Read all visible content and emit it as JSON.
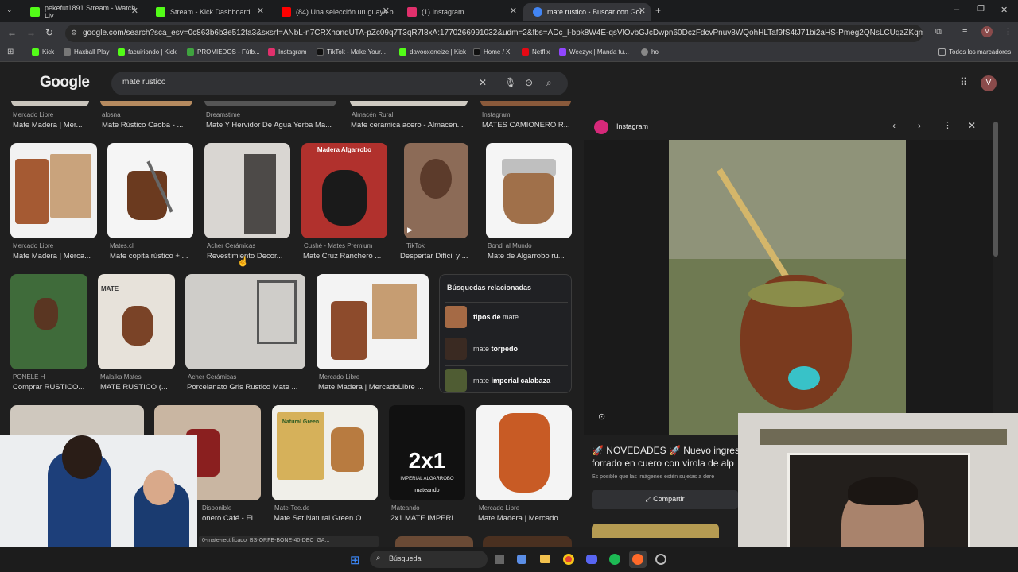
{
  "tabs": [
    {
      "label": "pekefut1891 Stream - Watch Liv",
      "color": "#53fc18"
    },
    {
      "label": "Stream - Kick Dashboard",
      "color": "#53fc18"
    },
    {
      "label": "(84) Una selección uruguaya b",
      "color": "#ff0000"
    },
    {
      "label": "(1) Instagram",
      "color": "#e1306c"
    },
    {
      "label": "mate rustico - Buscar con Goo",
      "color": "#4285f4"
    }
  ],
  "url": "google.com/search?sca_esv=0c863b6b3e512fa3&sxsrf=ANbL-n7CRXhondUTA-pZc09q7T3qR7I8xA:1770266991032&udm=2&fbs=ADc_l-bpk8W4E-qsVlOvbGJcDwpn60DczFdcvPnuv8WQohHLTaf9fS4tJ71bi2aHS-Pmeg2QNsLCUqzZKqmJKDQ4UhxYC...",
  "bookmarks": [
    "Kick",
    "Haxball Play",
    "facuiriondo | Kick",
    "PROMIEDOS - Fútb...",
    "Instagram",
    "TikTok - Make Your...",
    "davooxeneize | Kick",
    "Home / X",
    "Netflix",
    "Weezyx | Manda tu...",
    "ho"
  ],
  "bookmarks_all": "Todos los marcadores",
  "google": {
    "logo": "Google",
    "query": "mate rustico"
  },
  "row0": [
    {
      "src": "Mercado Libre",
      "cap": "Mate Madera | Mer..."
    },
    {
      "src": "alosna",
      "cap": "Mate Rústico Caoba - ..."
    },
    {
      "src": "Dreamstime",
      "cap": "Mate Y Hervidor De Agua Yerba Ma..."
    },
    {
      "src": "Almacén Rural",
      "cap": "Mate ceramica acero - Almacen..."
    },
    {
      "src": "Instagram",
      "cap": "MATES CAMIONERO R..."
    }
  ],
  "row1": [
    {
      "src": "Mercado Libre",
      "cap": "Mate Madera | Merca..."
    },
    {
      "src": "Mates.cl",
      "cap": "Mate copita rústico + ..."
    },
    {
      "src": "Acher Cerámicas",
      "cap": "Revestimiento Decor..."
    },
    {
      "src": "Cushé - Mates Premium",
      "cap": "Mate Cruz Ranchero ..."
    },
    {
      "src": "TikTok",
      "cap": "Despertar Difícil y ..."
    },
    {
      "src": "Bondi al Mundo",
      "cap": "Mate de Algarrobo ru..."
    }
  ],
  "row2": [
    {
      "src": "PONELE H",
      "cap": "Comprar RUSTICO..."
    },
    {
      "src": "Malaika Mates",
      "cap": "MATE RUSTICO (..."
    },
    {
      "src": "Acher Cerámicas",
      "cap": "Porcelanato Gris Rustico Mate ..."
    },
    {
      "src": "Mercado Libre",
      "cap": "Mate Madera | MercadoLibre ..."
    }
  ],
  "row3": [
    {
      "src": "Disponible",
      "cap": "onero Café - El ..."
    },
    {
      "src": "Mate-Tee.de",
      "cap": "Mate Set Natural Green O..."
    },
    {
      "src": "Mateando",
      "cap": "2x1 MATE IMPERI..."
    },
    {
      "src": "Mercado Libre",
      "cap": "Mate Madera | Mercado..."
    }
  ],
  "mate_label": "MATE",
  "nat_label": "Natural Green",
  "promo_label": "2x1",
  "promo_sub": "IMPERIAL ALGARROBO",
  "promo_brand": "mateando",
  "related": {
    "title": "Búsquedas relacionadas",
    "items": [
      {
        "pre": "tipos de",
        "post": "mate"
      },
      {
        "pre": "mate",
        "post": "torpedo"
      },
      {
        "pre": "mate",
        "post": "imperial calabaza"
      }
    ]
  },
  "panel": {
    "source": "Instagram",
    "title": "🚀 NOVEDADES 🚀 Nuevo ingreso forrado en cuero con virola de alp",
    "note": "Es posible que las imágenes estén sujetas a dere",
    "share": "Compartir"
  },
  "download": "0-mate-rectificado_BS-ORFE-BONE-40-DEC_GA...",
  "taskbar": {
    "search": "Búsqueda"
  },
  "colors": {
    "accent": "#8ab4f8",
    "bg": "#1f1f1f"
  }
}
